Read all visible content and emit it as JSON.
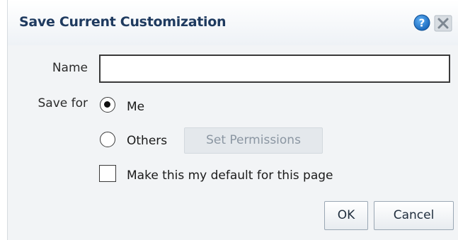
{
  "dialog": {
    "title": "Save Current Customization",
    "help_icon": "help-icon",
    "close_icon": "close-icon"
  },
  "form": {
    "name_label": "Name",
    "name_value": "",
    "save_for_label": "Save for",
    "options": [
      {
        "label": "Me",
        "selected": true
      },
      {
        "label": "Others",
        "selected": false
      }
    ],
    "set_permissions_label": "Set Permissions",
    "default_checkbox_label": "Make this my default for this page",
    "default_checked": false
  },
  "buttons": {
    "ok_label": "OK",
    "cancel_label": "Cancel"
  },
  "colors": {
    "title": "#1e3a5f",
    "help": "#1a73c8",
    "dialog_bg": "#f2f4f6"
  }
}
